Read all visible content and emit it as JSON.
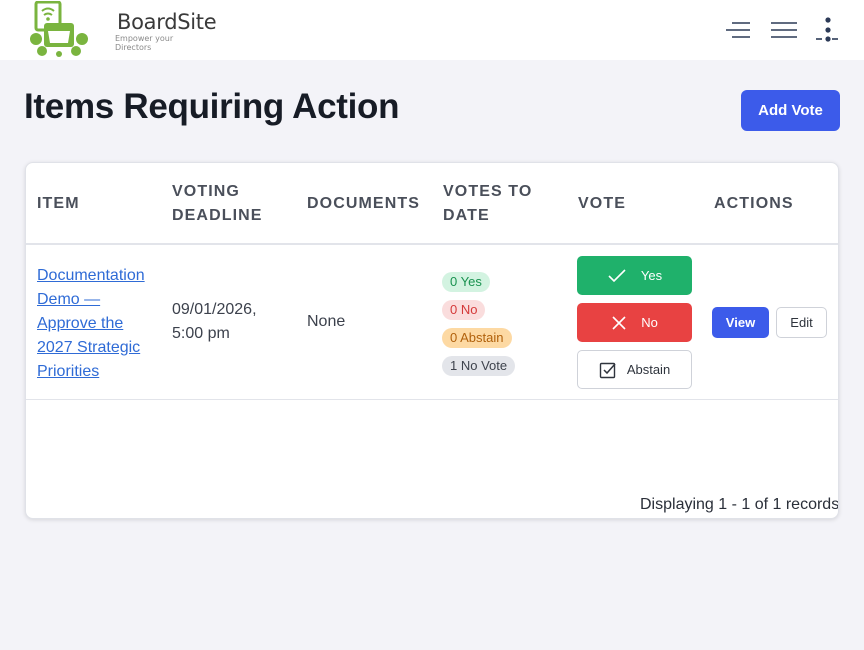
{
  "brand": {
    "name": "BoardSite",
    "tagline": "Empower your Directors",
    "color": "#7ab43f"
  },
  "topbar": {
    "icons": [
      "menu-indent-icon",
      "hamburger-menu-icon",
      "user-menu-icon"
    ]
  },
  "page": {
    "title": "Items Requiring Action",
    "add_label": "Add Vote"
  },
  "table": {
    "headers": {
      "item": "ITEM",
      "deadline_1": "VOTING",
      "deadline_2": "DEADLINE",
      "documents": "DOCUMENTS",
      "votes_1": "VOTES TO",
      "votes_2": "DATE",
      "vote": "VOTE",
      "actions": "ACTIONS"
    },
    "rows": [
      {
        "item": "Documentation Demo — Approve the 2027 Strategic Priorities",
        "deadline_date": "09/01/2026,",
        "deadline_time": "5:00 pm",
        "documents": "None",
        "tallies": {
          "yes": "0 Yes",
          "no": "0 No",
          "abstain": "0 Abstain",
          "no_vote": "1 No Vote"
        },
        "vote_buttons": {
          "yes": "Yes",
          "no": "No",
          "abstain": "Abstain"
        },
        "actions": {
          "view": "View",
          "edit": "Edit"
        }
      }
    ],
    "footer": "Displaying 1 - 1 of 1 records"
  },
  "colors": {
    "primary": "#3c5bea",
    "yes": "#1fb16b",
    "no": "#e84242",
    "abstain_badge": "#fdd9a3",
    "link": "#2f6bd6"
  }
}
